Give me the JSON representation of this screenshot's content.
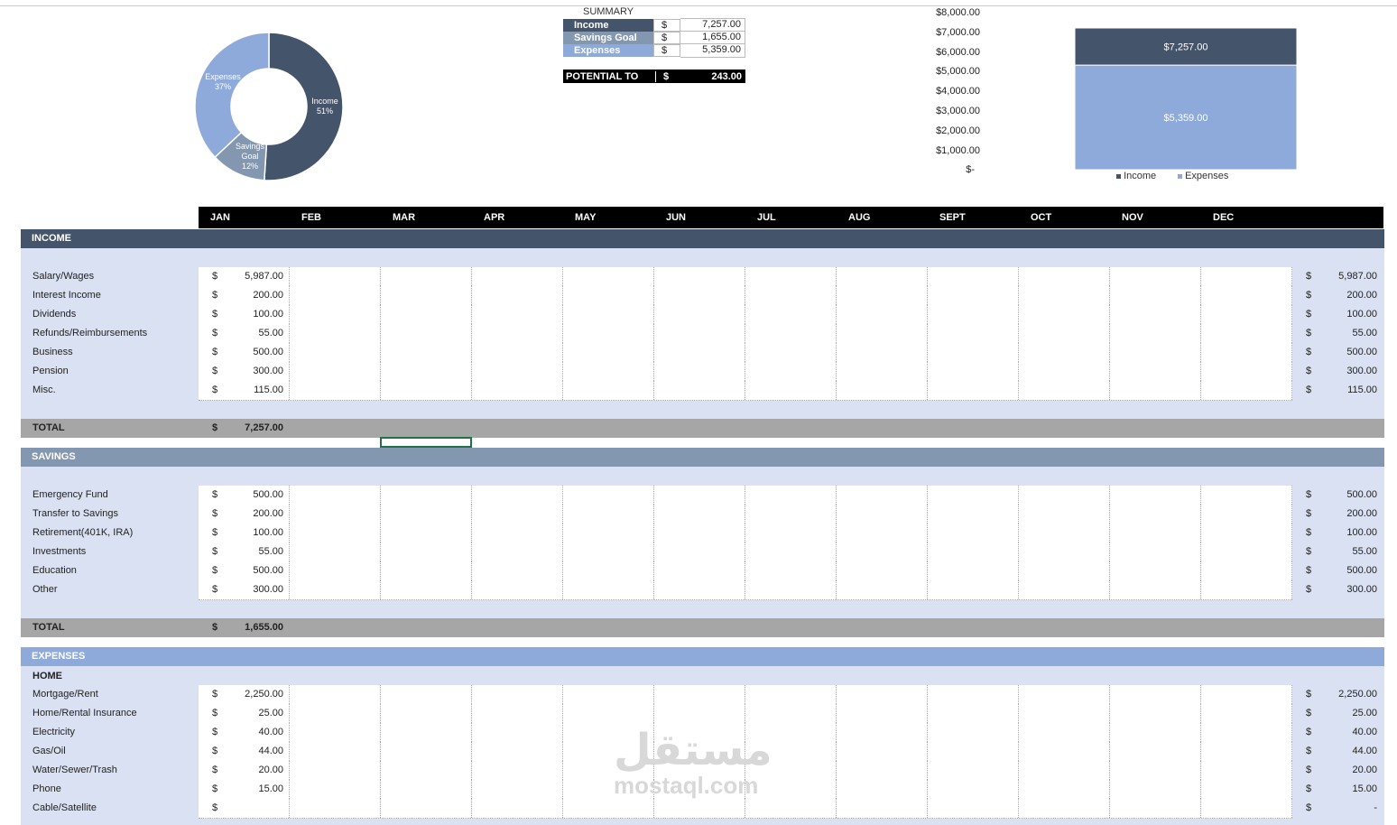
{
  "colors": {
    "income": "#44546a",
    "savings": "#8497b0",
    "expenses": "#8eaadb",
    "total": "#a6a6a6",
    "light": "#d9e1f2"
  },
  "donut": {
    "slices": [
      {
        "label": "Income",
        "pct": "51%",
        "value": 51
      },
      {
        "label": "Savings Goal",
        "pct": "12%",
        "value": 12
      },
      {
        "label": "Expenses",
        "pct": "37%",
        "value": 37
      }
    ]
  },
  "summary": {
    "title": "SUMMARY",
    "rows": [
      {
        "label": "Income",
        "cur": "$",
        "value": "7,257.00"
      },
      {
        "label": "Savings Goal",
        "cur": "$",
        "value": "1,655.00"
      },
      {
        "label": "Expenses",
        "cur": "$",
        "value": "5,359.00"
      }
    ],
    "potential": {
      "label": "POTENTIAL TO",
      "cur": "$",
      "value": "243.00"
    }
  },
  "chart_data": {
    "type": "bar",
    "categories": [
      "Income",
      "Expenses"
    ],
    "values": [
      7257,
      5359
    ],
    "data_labels": [
      "$7,257.00",
      "$5,359.00"
    ],
    "ylim": [
      0,
      8000
    ],
    "yticks": [
      "$8,000.00",
      "$7,000.00",
      "$6,000.00",
      "$5,000.00",
      "$4,000.00",
      "$3,000.00",
      "$2,000.00",
      "$1,000.00",
      "$-"
    ],
    "legend": [
      "Income",
      "Expenses"
    ]
  },
  "months": [
    "JAN",
    "FEB",
    "MAR",
    "APR",
    "MAY",
    "JUN",
    "JUL",
    "AUG",
    "SEPT",
    "OCT",
    "NOV",
    "DEC"
  ],
  "income": {
    "title": "INCOME",
    "rows": [
      {
        "label": "Salary/Wages",
        "value": "5,987.00",
        "total": "5,987.00"
      },
      {
        "label": "Interest Income",
        "value": "200.00",
        "total": "200.00"
      },
      {
        "label": "Dividends",
        "value": "100.00",
        "total": "100.00"
      },
      {
        "label": "Refunds/Reimbursements",
        "value": "55.00",
        "total": "55.00"
      },
      {
        "label": "Business",
        "value": "500.00",
        "total": "500.00"
      },
      {
        "label": "Pension",
        "value": "300.00",
        "total": "300.00"
      },
      {
        "label": "Misc.",
        "value": "115.00",
        "total": "115.00"
      }
    ],
    "total_label": "TOTAL",
    "total_value": "7,257.00"
  },
  "savings": {
    "title": "SAVINGS",
    "rows": [
      {
        "label": "Emergency Fund",
        "value": "500.00",
        "total": "500.00"
      },
      {
        "label": "Transfer to Savings",
        "value": "200.00",
        "total": "200.00"
      },
      {
        "label": "Retirement(401K, IRA)",
        "value": "100.00",
        "total": "100.00"
      },
      {
        "label": "Investments",
        "value": "55.00",
        "total": "55.00"
      },
      {
        "label": "Education",
        "value": "500.00",
        "total": "500.00"
      },
      {
        "label": "Other",
        "value": "300.00",
        "total": "300.00"
      }
    ],
    "total_label": "TOTAL",
    "total_value": "1,655.00"
  },
  "expenses": {
    "title": "EXPENSES",
    "subhead": "HOME",
    "rows": [
      {
        "label": "Mortgage/Rent",
        "value": "2,250.00",
        "total": "2,250.00"
      },
      {
        "label": "Home/Rental Insurance",
        "value": "25.00",
        "total": "25.00"
      },
      {
        "label": "Electricity",
        "value": "40.00",
        "total": "40.00"
      },
      {
        "label": "Gas/Oil",
        "value": "44.00",
        "total": "44.00"
      },
      {
        "label": "Water/Sewer/Trash",
        "value": "20.00",
        "total": "20.00"
      },
      {
        "label": "Phone",
        "value": "15.00",
        "total": "15.00"
      },
      {
        "label": "Cable/Satellite",
        "value": "",
        "total": "-"
      }
    ]
  },
  "currency": "$",
  "watermark": {
    "arabic": "مستقل",
    "latin": "mostaql.com"
  }
}
